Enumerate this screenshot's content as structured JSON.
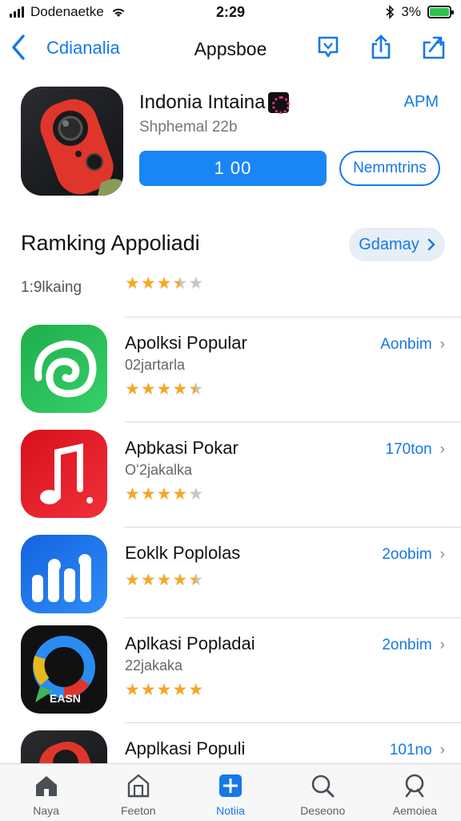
{
  "status_bar": {
    "carrier": "Dodenaetke",
    "time": "2:29",
    "battery": "3%"
  },
  "nav": {
    "back_label": "Cdianalia",
    "title": "Appsboe",
    "actions": [
      "bookmark-icon",
      "share-icon",
      "export-icon"
    ]
  },
  "featured": {
    "name": "Indonia Intaina",
    "right_label": "APM",
    "subtitle": "Shphemal 22b",
    "get_label": "1 00",
    "secondary_label": "Nemmtrins"
  },
  "ranking": {
    "title": "Ramking Appoliadi",
    "button_label": "Gdamay",
    "label": "1:9lkaing",
    "rating": 3.5
  },
  "apps": [
    {
      "title": "Apolksi Popular",
      "subtitle": "02jartarla",
      "rating": 4.5,
      "action": "Aonbim",
      "icon": "swirl-icon",
      "colors": [
        "#1fae4c",
        "#2ccc62"
      ]
    },
    {
      "title": "Apbkasi Pokar",
      "subtitle": "Oʻ2jakalka",
      "rating": 4.0,
      "action": "170ton",
      "icon": "music-note-icon",
      "colors": [
        "#d8101c",
        "#f0303a"
      ]
    },
    {
      "title": "Eoklk Poplolas",
      "subtitle": "",
      "rating": 4.5,
      "action": "2oobim",
      "icon": "bars-icon",
      "colors": [
        "#1463e0",
        "#2e8df7"
      ]
    },
    {
      "title": "Aplkasi Popladai",
      "subtitle": "22jakaka",
      "rating": 5.0,
      "action": "2onbim",
      "icon": "chat-ring-icon",
      "colors": [
        "#111111",
        "#222222"
      ]
    },
    {
      "title": "Applkasi Populi",
      "subtitle": "",
      "rating": 0,
      "action": "101no",
      "icon": "camera-icon",
      "colors": [
        "#1c1c1e",
        "#2a2a2c"
      ]
    }
  ],
  "tabs": [
    {
      "label": "Naya",
      "icon": "home-icon",
      "active": false
    },
    {
      "label": "Feeton",
      "icon": "store-icon",
      "active": false
    },
    {
      "label": "Notiia",
      "icon": "grid-icon",
      "active": true
    },
    {
      "label": "Deseono",
      "icon": "search-icon",
      "active": false
    },
    {
      "label": "Aemoiea",
      "icon": "search-alt-icon",
      "active": false
    }
  ],
  "colors": {
    "accent": "#1478e6",
    "star": "#f5a623",
    "star_off": "#c6c6c6"
  }
}
